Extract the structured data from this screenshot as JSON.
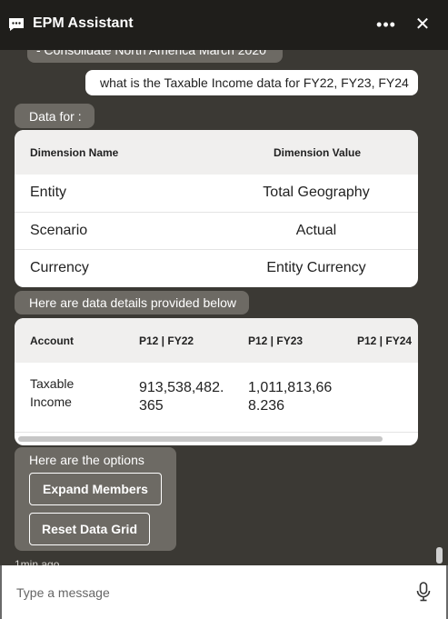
{
  "header": {
    "title": "EPM Assistant",
    "more_glyph": "•••",
    "close_glyph": "✕"
  },
  "conversation": {
    "prev_bubble": "- Consolidate North America March 2020",
    "user_message": "what is the Taxable Income data for FY22, FY23, FY24",
    "data_for_label": "Data for :",
    "dimensions": {
      "headers": [
        "Dimension Name",
        "Dimension Value"
      ],
      "rows": [
        [
          "Entity",
          "Total Geography"
        ],
        [
          "Scenario",
          "Actual"
        ],
        [
          "Currency",
          "Entity Currency"
        ]
      ]
    },
    "details_label": "Here are data details provided below",
    "accounts": {
      "headers": [
        "Account",
        "P12 | FY22",
        "P12 | FY23",
        "P12 | FY24"
      ],
      "rows": [
        [
          "Taxable Income",
          "913,538,482.365",
          "1,011,813,668.236",
          ""
        ]
      ],
      "horizontal_scroll_fraction": 0.92
    },
    "options": {
      "label": "Here are the options",
      "buttons": [
        "Expand Members",
        "Reset Data Grid"
      ]
    },
    "timestamp": "1min ago"
  },
  "composer": {
    "placeholder": "Type a message"
  },
  "colors": {
    "header_bg": "#1f1e1b",
    "panel_bg": "#3b3934",
    "bubble_bg": "#6d6a64"
  },
  "icons": {
    "header_left": "chat-icon",
    "more": "more-icon",
    "close": "close-icon",
    "mic": "microphone-icon"
  }
}
